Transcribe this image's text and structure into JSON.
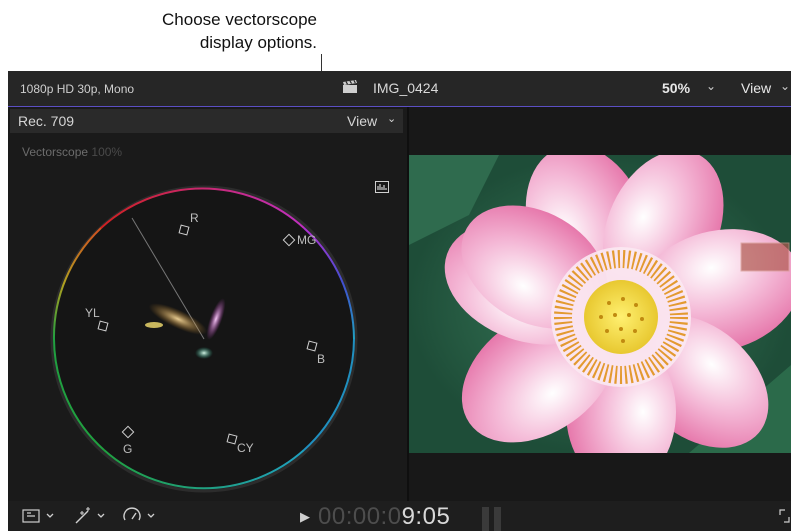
{
  "callout": {
    "line1": "Choose vectorscope",
    "line2": "display options."
  },
  "topbar": {
    "format": "1080p HD 30p, Mono",
    "clip_icon": "clapperboard-icon",
    "clip_name": "IMG_0424",
    "zoom": "50%",
    "view": "View",
    "accent_color": "#5b4fc4"
  },
  "scope": {
    "standard": "Rec. 709",
    "view": "View",
    "label": "Vectorscope",
    "brightness": "100%",
    "options_icon": "vectorscope-display-options-icon",
    "targets": {
      "r": "R",
      "mg": "MG",
      "b": "B",
      "cy": "CY",
      "g": "G",
      "yl": "YL"
    }
  },
  "bottom": {
    "timecode_dim": "00:00:0",
    "timecode_bright": "9:05",
    "icons": [
      "clip-appearance-icon",
      "transform-tools-icon",
      "retime-speed-icon",
      "play-icon",
      "fullscreen-icon"
    ]
  }
}
